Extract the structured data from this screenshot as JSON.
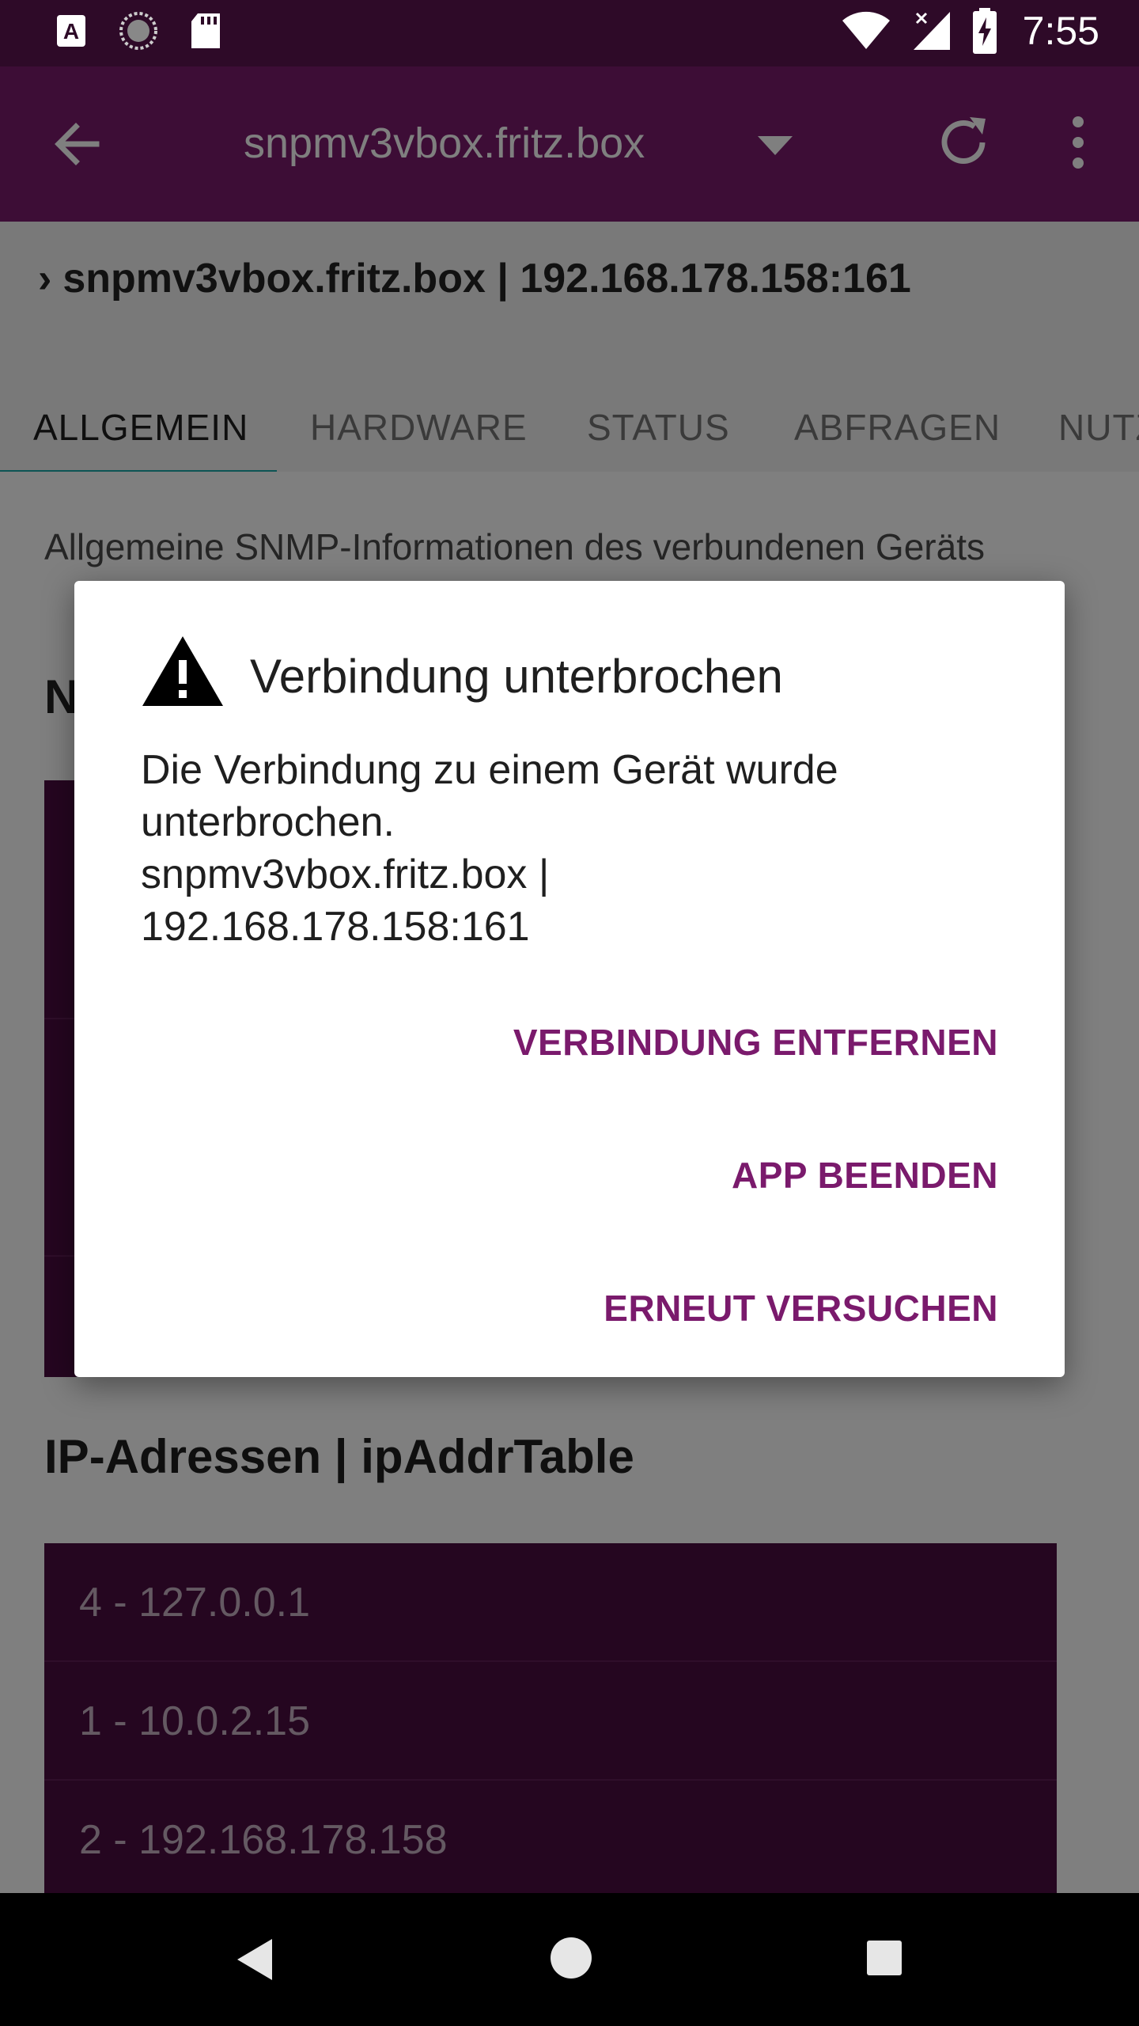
{
  "status_bar": {
    "time": "7:55",
    "left_icons": [
      "accessibility-a-icon",
      "sync-spinner-icon",
      "sd-card-icon"
    ],
    "right_icons": [
      "wifi-icon",
      "cellular-signal-icon",
      "battery-charging-icon"
    ]
  },
  "app_bar": {
    "title": "snpmv3vbox.fritz.box",
    "icons": [
      "back-arrow-icon",
      "dropdown-caret-icon",
      "refresh-icon",
      "more-vert-icon"
    ]
  },
  "breadcrumb": {
    "chevron": "›",
    "text": "snpmv3vbox.fritz.box | 192.168.178.158:161"
  },
  "tabs": [
    {
      "label": "ALLGEMEIN",
      "active": true
    },
    {
      "label": "HARDWARE",
      "active": false
    },
    {
      "label": "STATUS",
      "active": false
    },
    {
      "label": "ABFRAGEN",
      "active": false
    },
    {
      "label": "NUTZ",
      "active": false
    }
  ],
  "content": {
    "subtitle": "Allgemeine SNMP-Informationen des verbundenen Geräts",
    "section1_letter": "N",
    "section2_title": "IP-Adressen | ipAddrTable",
    "ip_rows": [
      "4 - 127.0.0.1",
      "1 - 10.0.2.15",
      "2 - 192.168.178.158"
    ]
  },
  "dialog": {
    "title": "Verbindung unterbrochen",
    "message_lines": [
      "Die Verbindung zu einem Gerät wurde",
      "unterbrochen.",
      "snpmv3vbox.fritz.box |",
      "192.168.178.158:161"
    ],
    "buttons": [
      {
        "label": "VERBINDUNG ENTFERNEN"
      },
      {
        "label": "APP BEENDEN"
      },
      {
        "label": "ERNEUT VERSUCHEN"
      }
    ]
  },
  "colors": {
    "primary": "#7a1a6c",
    "status_bar": "#2e0a28",
    "tab_indicator": "#1aa8a8",
    "card": "#4a0d40"
  }
}
